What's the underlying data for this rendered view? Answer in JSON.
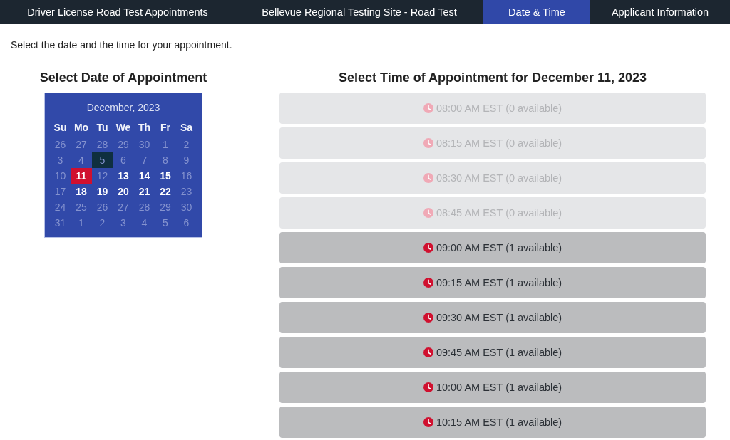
{
  "tabs": [
    {
      "label": "Driver License Road Test Appointments",
      "selected": false
    },
    {
      "label": "Bellevue Regional Testing Site - Road Test",
      "selected": false
    },
    {
      "label": "Date & Time",
      "selected": true
    },
    {
      "label": "Applicant Information",
      "selected": false
    }
  ],
  "instruction": "Select the date and the time for your appointment.",
  "date_section": {
    "heading": "Select Date of Appointment",
    "calendar": {
      "title": "December, 2023",
      "weekdays": [
        "Su",
        "Mo",
        "Tu",
        "We",
        "Th",
        "Fr",
        "Sa"
      ],
      "weeks": [
        [
          {
            "label": "26",
            "available": false,
            "today": false,
            "selected": false
          },
          {
            "label": "27",
            "available": false,
            "today": false,
            "selected": false
          },
          {
            "label": "28",
            "available": false,
            "today": false,
            "selected": false
          },
          {
            "label": "29",
            "available": false,
            "today": false,
            "selected": false
          },
          {
            "label": "30",
            "available": false,
            "today": false,
            "selected": false
          },
          {
            "label": "1",
            "available": false,
            "today": false,
            "selected": false
          },
          {
            "label": "2",
            "available": false,
            "today": false,
            "selected": false
          }
        ],
        [
          {
            "label": "3",
            "available": false,
            "today": false,
            "selected": false
          },
          {
            "label": "4",
            "available": false,
            "today": false,
            "selected": false
          },
          {
            "label": "5",
            "available": false,
            "today": true,
            "selected": false
          },
          {
            "label": "6",
            "available": false,
            "today": false,
            "selected": false
          },
          {
            "label": "7",
            "available": false,
            "today": false,
            "selected": false
          },
          {
            "label": "8",
            "available": false,
            "today": false,
            "selected": false
          },
          {
            "label": "9",
            "available": false,
            "today": false,
            "selected": false
          }
        ],
        [
          {
            "label": "10",
            "available": false,
            "today": false,
            "selected": false
          },
          {
            "label": "11",
            "available": true,
            "today": false,
            "selected": true
          },
          {
            "label": "12",
            "available": false,
            "today": false,
            "selected": false
          },
          {
            "label": "13",
            "available": true,
            "today": false,
            "selected": false
          },
          {
            "label": "14",
            "available": true,
            "today": false,
            "selected": false
          },
          {
            "label": "15",
            "available": true,
            "today": false,
            "selected": false
          },
          {
            "label": "16",
            "available": false,
            "today": false,
            "selected": false
          }
        ],
        [
          {
            "label": "17",
            "available": false,
            "today": false,
            "selected": false
          },
          {
            "label": "18",
            "available": true,
            "today": false,
            "selected": false
          },
          {
            "label": "19",
            "available": true,
            "today": false,
            "selected": false
          },
          {
            "label": "20",
            "available": true,
            "today": false,
            "selected": false
          },
          {
            "label": "21",
            "available": true,
            "today": false,
            "selected": false
          },
          {
            "label": "22",
            "available": true,
            "today": false,
            "selected": false
          },
          {
            "label": "23",
            "available": false,
            "today": false,
            "selected": false
          }
        ],
        [
          {
            "label": "24",
            "available": false,
            "today": false,
            "selected": false
          },
          {
            "label": "25",
            "available": false,
            "today": false,
            "selected": false
          },
          {
            "label": "26",
            "available": false,
            "today": false,
            "selected": false
          },
          {
            "label": "27",
            "available": false,
            "today": false,
            "selected": false
          },
          {
            "label": "28",
            "available": false,
            "today": false,
            "selected": false
          },
          {
            "label": "29",
            "available": false,
            "today": false,
            "selected": false
          },
          {
            "label": "30",
            "available": false,
            "today": false,
            "selected": false
          }
        ],
        [
          {
            "label": "31",
            "available": false,
            "today": false,
            "selected": false
          },
          {
            "label": "1",
            "available": false,
            "today": false,
            "selected": false
          },
          {
            "label": "2",
            "available": false,
            "today": false,
            "selected": false
          },
          {
            "label": "3",
            "available": false,
            "today": false,
            "selected": false
          },
          {
            "label": "4",
            "available": false,
            "today": false,
            "selected": false
          },
          {
            "label": "5",
            "available": false,
            "today": false,
            "selected": false
          },
          {
            "label": "6",
            "available": false,
            "today": false,
            "selected": false
          }
        ]
      ]
    }
  },
  "time_section": {
    "heading": "Select Time of Appointment for December 11, 2023",
    "slots": [
      {
        "label": "08:00 AM EST (0 available)",
        "disabled": true
      },
      {
        "label": "08:15 AM EST (0 available)",
        "disabled": true
      },
      {
        "label": "08:30 AM EST (0 available)",
        "disabled": true
      },
      {
        "label": "08:45 AM EST (0 available)",
        "disabled": true
      },
      {
        "label": "09:00 AM EST (1 available)",
        "disabled": false
      },
      {
        "label": "09:15 AM EST (1 available)",
        "disabled": false
      },
      {
        "label": "09:30 AM EST (1 available)",
        "disabled": false
      },
      {
        "label": "09:45 AM EST (1 available)",
        "disabled": false
      },
      {
        "label": "10:00 AM EST (1 available)",
        "disabled": false
      },
      {
        "label": "10:15 AM EST (1 available)",
        "disabled": false
      }
    ]
  }
}
